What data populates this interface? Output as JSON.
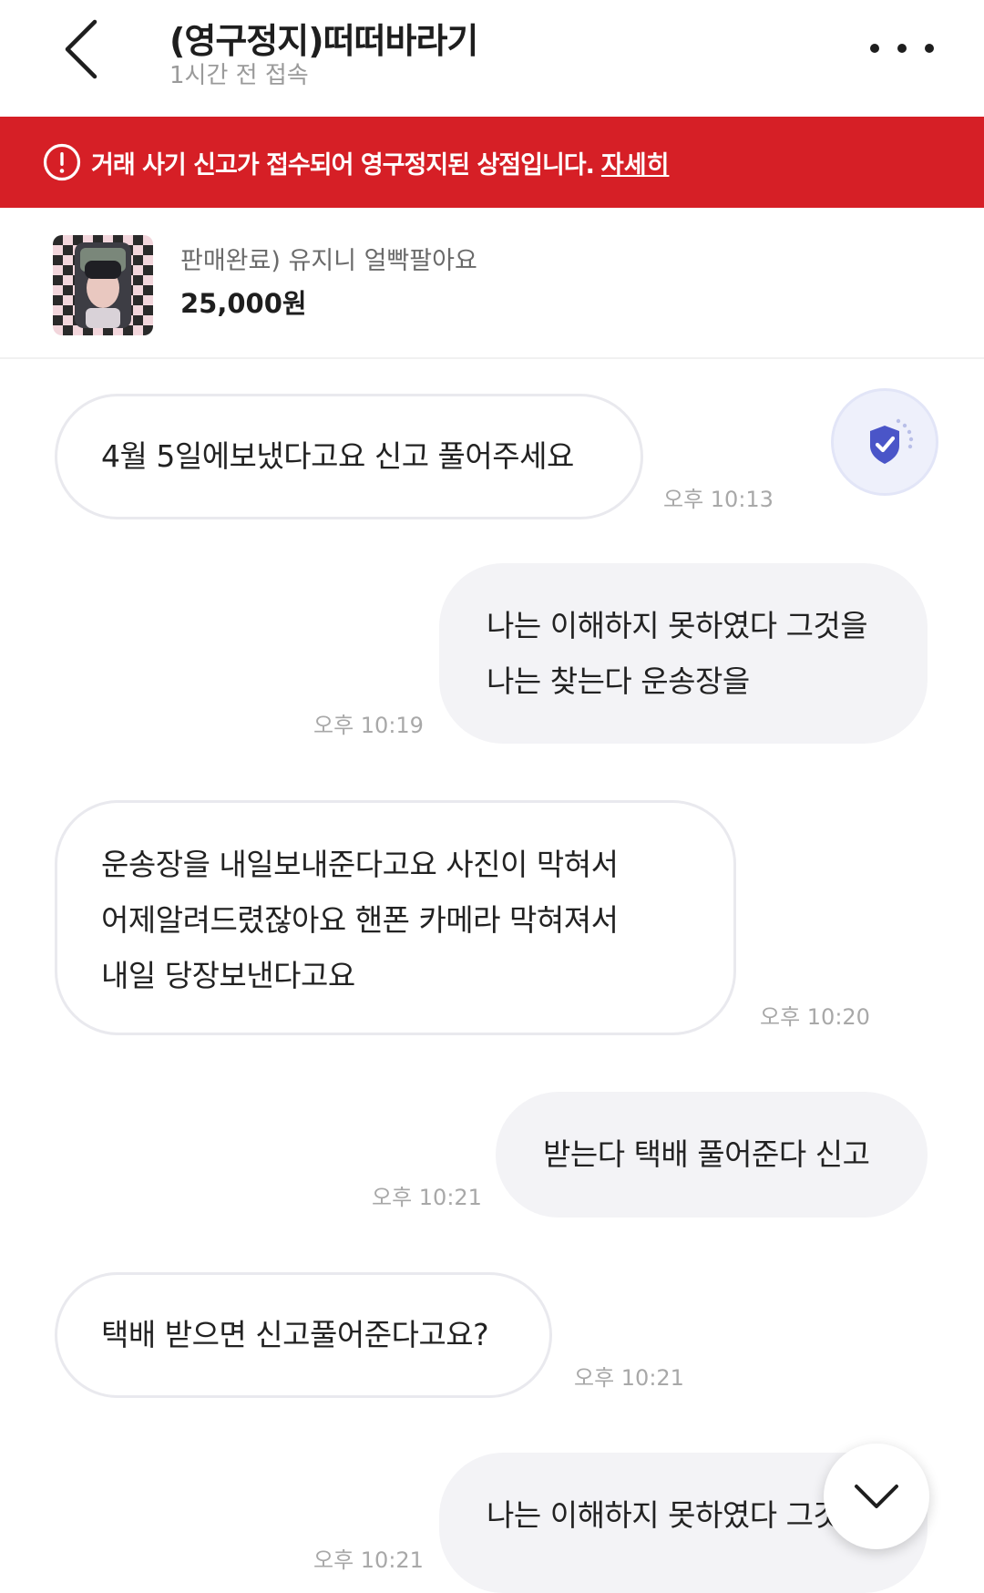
{
  "header": {
    "title": "(영구정지)떠떠바라기",
    "subtitle": "1시간 전 접속",
    "back_icon": "chevron-left-icon",
    "more_icon": "more-horizontal-icon"
  },
  "banner": {
    "text": "거래 사기 신고가 접수되어 영구정지된 상점입니다.",
    "link": "자세히",
    "color": "#d61f26",
    "icon": "alert-circle-icon"
  },
  "product": {
    "name": "판매완료) 유지니 얼빡팔아요",
    "price": "25,000원"
  },
  "messages": [
    {
      "direction": "in",
      "lines": [
        "4월 5일에보냈다고요 신고 풀어주세요"
      ],
      "time": "오후 10:13"
    },
    {
      "direction": "out",
      "lines": [
        "나는 이해하지 못하였다 그것을",
        "나는 찾는다 운송장을"
      ],
      "time": "오후 10:19"
    },
    {
      "direction": "in",
      "lines": [
        "운송장을 내일보내준다고요 사진이 막혀서",
        "어제알려드렸잖아요 핸폰 카메라 막혀져서",
        "내일 당장보낸다고요"
      ],
      "time": "오후 10:20"
    },
    {
      "direction": "out",
      "lines": [
        "받는다 택배 풀어준다 신고"
      ],
      "time": "오후 10:21"
    },
    {
      "direction": "in",
      "lines": [
        "택배 받으면 신고풀어준다고요?"
      ],
      "time": "오후 10:21"
    },
    {
      "direction": "out",
      "lines": [
        "나는 이해하지 못하였다 그것"
      ],
      "time": "오후 10:21"
    }
  ],
  "floating": {
    "shield_icon": "shield-check-icon",
    "scroll_icon": "chevron-down-icon",
    "accent": "#4a55c8"
  }
}
